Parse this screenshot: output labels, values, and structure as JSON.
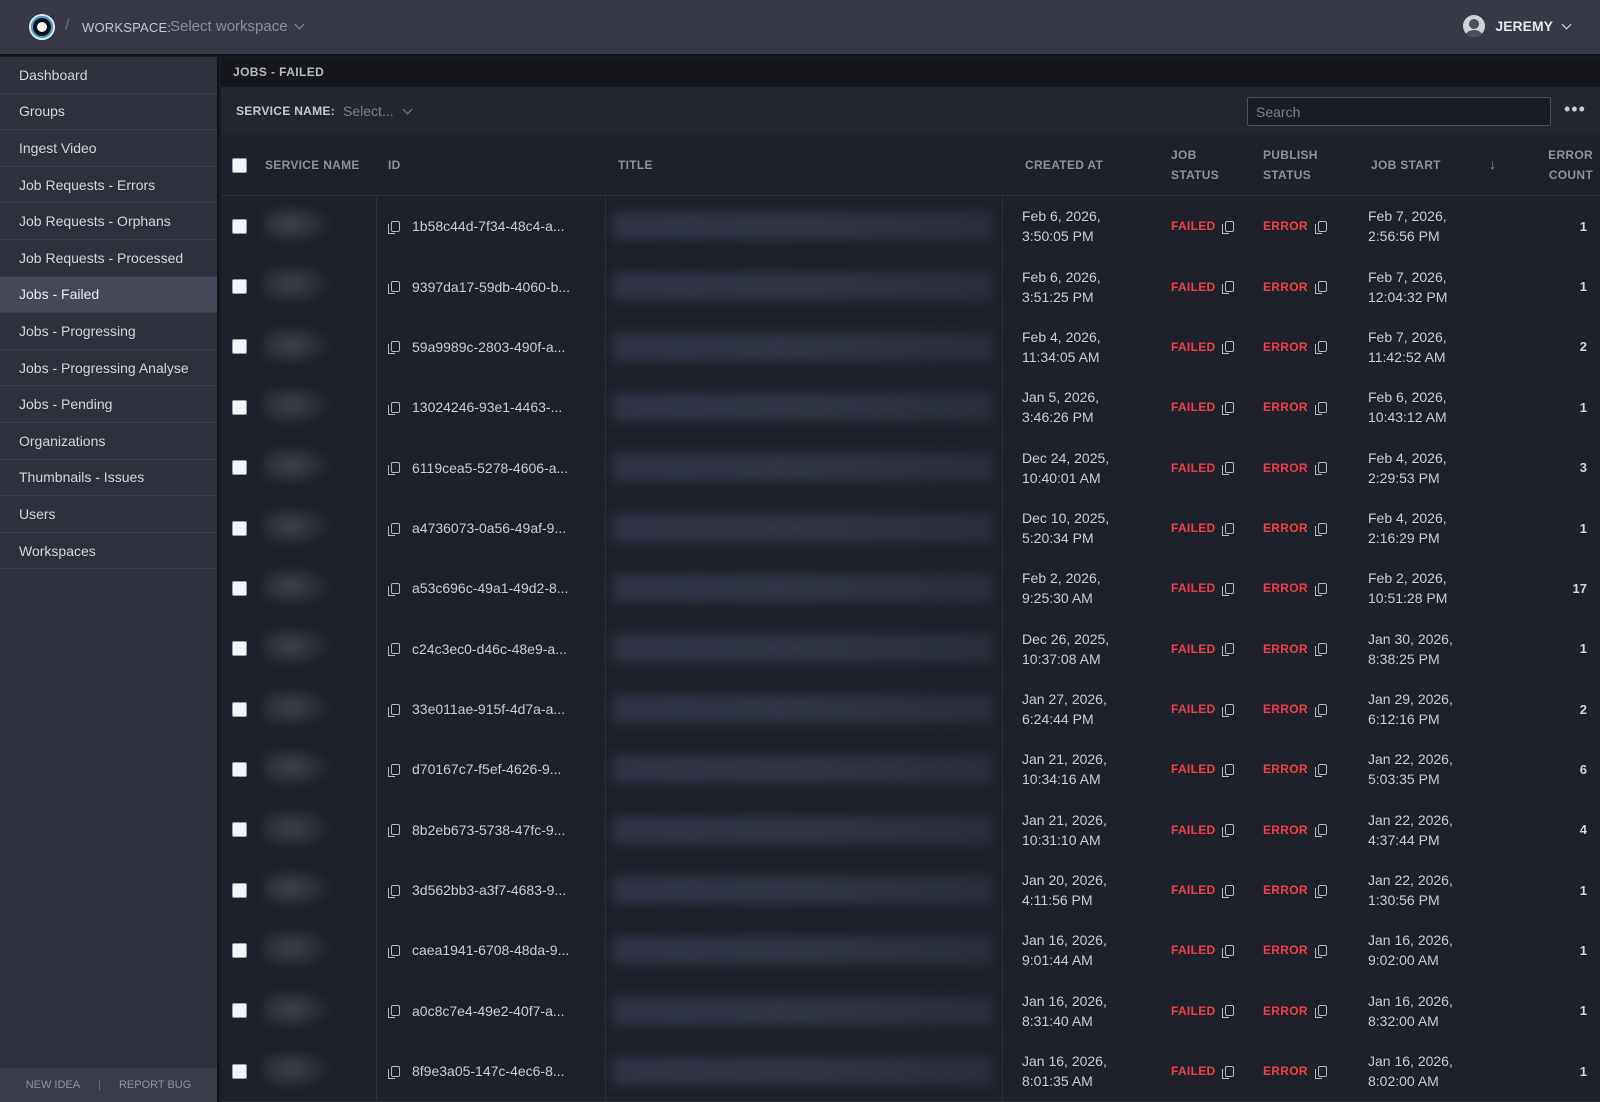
{
  "topbar": {
    "workspace_label": "WORKSPACE:",
    "workspace_placeholder": "Select workspace",
    "user_name": "JEREMY"
  },
  "sidebar": {
    "items": [
      {
        "label": "Dashboard"
      },
      {
        "label": "Groups"
      },
      {
        "label": "Ingest Video"
      },
      {
        "label": "Job Requests - Errors"
      },
      {
        "label": "Job Requests - Orphans"
      },
      {
        "label": "Job Requests - Processed"
      },
      {
        "label": "Jobs - Failed"
      },
      {
        "label": "Jobs - Progressing"
      },
      {
        "label": "Jobs - Progressing Analyse"
      },
      {
        "label": "Jobs - Pending"
      },
      {
        "label": "Organizations"
      },
      {
        "label": "Thumbnails - Issues"
      },
      {
        "label": "Users"
      },
      {
        "label": "Workspaces"
      }
    ],
    "active_index": 6,
    "footer": {
      "new_idea": "NEW IDEA",
      "report_bug": "REPORT BUG"
    }
  },
  "main": {
    "section_title": "JOBS - FAILED",
    "filter": {
      "label": "SERVICE NAME:",
      "placeholder": "Select..."
    },
    "search_placeholder": "Search",
    "table": {
      "headers": {
        "service_name": "SERVICE NAME",
        "id": "ID",
        "title": "TITLE",
        "created_at": "CREATED AT",
        "job_status_1": "JOB",
        "job_status_2": "STATUS",
        "publish_status_1": "PUBLISH",
        "publish_status_2": "STATUS",
        "job_start": "JOB START",
        "error_count_1": "ERROR",
        "error_count_2": "COUNT"
      },
      "rows": [
        {
          "id": "1b58c44d-7f34-48c4-a...",
          "created_1": "Feb 6, 2026,",
          "created_2": "3:50:05 PM",
          "job_status": "FAILED",
          "publish_status": "ERROR",
          "start_1": "Feb 7, 2026,",
          "start_2": "2:56:56 PM",
          "error_count": "1"
        },
        {
          "id": "9397da17-59db-4060-b...",
          "created_1": "Feb 6, 2026,",
          "created_2": "3:51:25 PM",
          "job_status": "FAILED",
          "publish_status": "ERROR",
          "start_1": "Feb 7, 2026,",
          "start_2": "12:04:32 PM",
          "error_count": "1"
        },
        {
          "id": "59a9989c-2803-490f-a...",
          "created_1": "Feb 4, 2026,",
          "created_2": "11:34:05 AM",
          "job_status": "FAILED",
          "publish_status": "ERROR",
          "start_1": "Feb 7, 2026,",
          "start_2": "11:42:52 AM",
          "error_count": "2"
        },
        {
          "id": "13024246-93e1-4463-...",
          "created_1": "Jan 5, 2026,",
          "created_2": "3:46:26 PM",
          "job_status": "FAILED",
          "publish_status": "ERROR",
          "start_1": "Feb 6, 2026,",
          "start_2": "10:43:12 AM",
          "error_count": "1"
        },
        {
          "id": "6119cea5-5278-4606-a...",
          "created_1": "Dec 24, 2025,",
          "created_2": "10:40:01 AM",
          "job_status": "FAILED",
          "publish_status": "ERROR",
          "start_1": "Feb 4, 2026,",
          "start_2": "2:29:53 PM",
          "error_count": "3"
        },
        {
          "id": "a4736073-0a56-49af-9...",
          "created_1": "Dec 10, 2025,",
          "created_2": "5:20:34 PM",
          "job_status": "FAILED",
          "publish_status": "ERROR",
          "start_1": "Feb 4, 2026,",
          "start_2": "2:16:29 PM",
          "error_count": "1"
        },
        {
          "id": "a53c696c-49a1-49d2-8...",
          "created_1": "Feb 2, 2026,",
          "created_2": "9:25:30 AM",
          "job_status": "FAILED",
          "publish_status": "ERROR",
          "start_1": "Feb 2, 2026,",
          "start_2": "10:51:28 PM",
          "error_count": "17"
        },
        {
          "id": "c24c3ec0-d46c-48e9-a...",
          "created_1": "Dec 26, 2025,",
          "created_2": "10:37:08 AM",
          "job_status": "FAILED",
          "publish_status": "ERROR",
          "start_1": "Jan 30, 2026,",
          "start_2": "8:38:25 PM",
          "error_count": "1"
        },
        {
          "id": "33e011ae-915f-4d7a-a...",
          "created_1": "Jan 27, 2026,",
          "created_2": "6:24:44 PM",
          "job_status": "FAILED",
          "publish_status": "ERROR",
          "start_1": "Jan 29, 2026,",
          "start_2": "6:12:16 PM",
          "error_count": "2"
        },
        {
          "id": "d70167c7-f5ef-4626-9...",
          "created_1": "Jan 21, 2026,",
          "created_2": "10:34:16 AM",
          "job_status": "FAILED",
          "publish_status": "ERROR",
          "start_1": "Jan 22, 2026,",
          "start_2": "5:03:35 PM",
          "error_count": "6"
        },
        {
          "id": "8b2eb673-5738-47fc-9...",
          "created_1": "Jan 21, 2026,",
          "created_2": "10:31:10 AM",
          "job_status": "FAILED",
          "publish_status": "ERROR",
          "start_1": "Jan 22, 2026,",
          "start_2": "4:37:44 PM",
          "error_count": "4"
        },
        {
          "id": "3d562bb3-a3f7-4683-9...",
          "created_1": "Jan 20, 2026,",
          "created_2": "4:11:56 PM",
          "job_status": "FAILED",
          "publish_status": "ERROR",
          "start_1": "Jan 22, 2026,",
          "start_2": "1:30:56 PM",
          "error_count": "1"
        },
        {
          "id": "caea1941-6708-48da-9...",
          "created_1": "Jan 16, 2026,",
          "created_2": "9:01:44 AM",
          "job_status": "FAILED",
          "publish_status": "ERROR",
          "start_1": "Jan 16, 2026,",
          "start_2": "9:02:00 AM",
          "error_count": "1"
        },
        {
          "id": "a0c8c7e4-49e2-40f7-a...",
          "created_1": "Jan 16, 2026,",
          "created_2": "8:31:40 AM",
          "job_status": "FAILED",
          "publish_status": "ERROR",
          "start_1": "Jan 16, 2026,",
          "start_2": "8:32:00 AM",
          "error_count": "1"
        },
        {
          "id": "8f9e3a05-147c-4ec6-8...",
          "created_1": "Jan 16, 2026,",
          "created_2": "8:01:35 AM",
          "job_status": "FAILED",
          "publish_status": "ERROR",
          "start_1": "Jan 16, 2026,",
          "start_2": "8:02:00 AM",
          "error_count": "1"
        }
      ]
    }
  }
}
